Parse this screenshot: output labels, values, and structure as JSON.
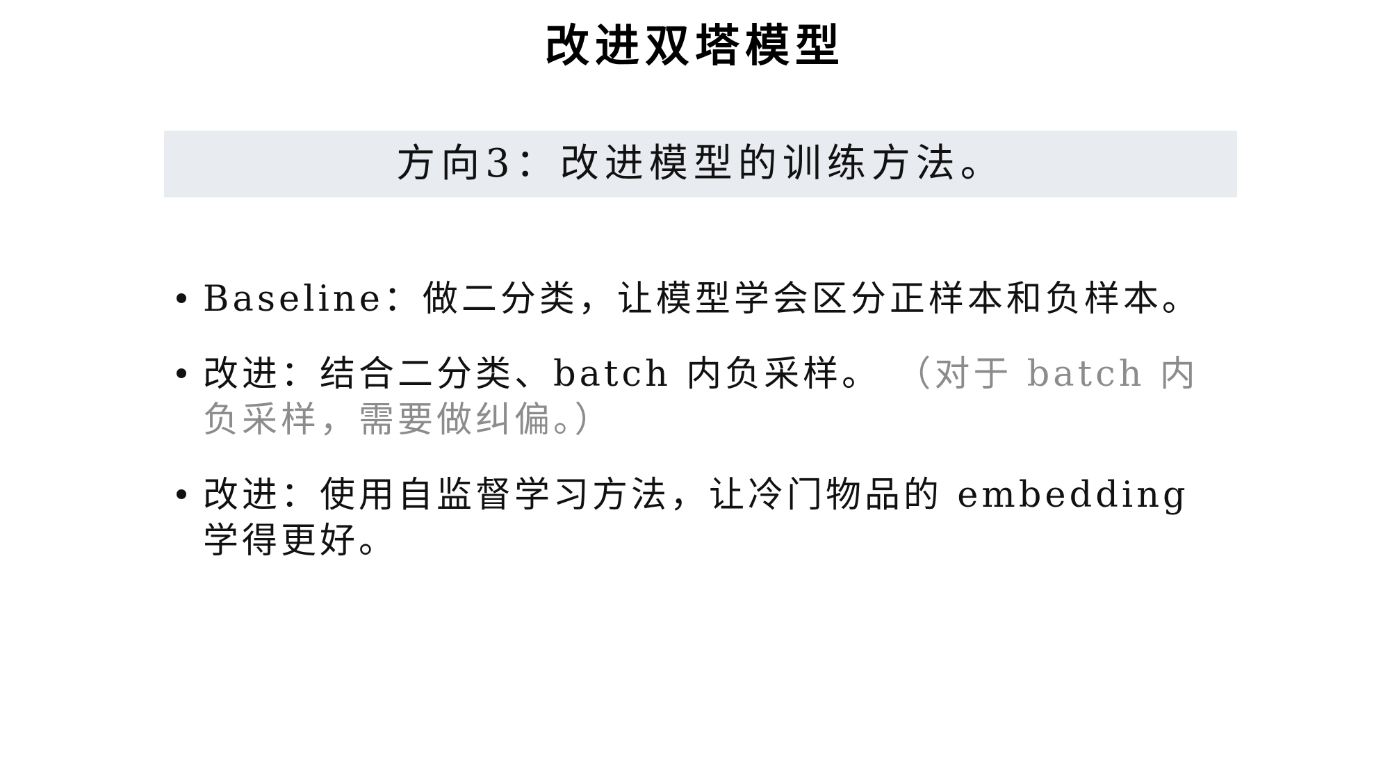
{
  "slide": {
    "title": "改进双塔模型",
    "banner": "方向3：改进模型的训练方法。",
    "bullets": [
      {
        "text": "Baseline：做二分类，让模型学会区分正样本和负样本。",
        "note": ""
      },
      {
        "text": "改进：结合二分类、batch 内负采样。",
        "note": "（对于 batch 内负采样，需要做纠偏。）"
      },
      {
        "text": "改进：使用自监督学习方法，让冷门物品的 embedding 学得更好。",
        "note": ""
      }
    ]
  },
  "colors": {
    "banner_bg": "#e8ebf0",
    "text": "#111111",
    "muted_text": "#8c8c8c"
  }
}
